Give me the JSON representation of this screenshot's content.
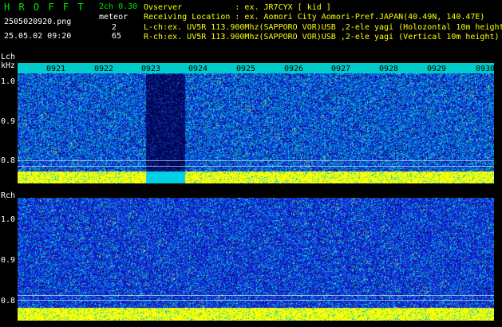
{
  "header": {
    "app_name": "H R O F F T",
    "mode": "2ch 0.30",
    "detect_label": "meteor",
    "filename": "2505020920.png",
    "datetime": "25.05.02 09:20",
    "count_l": "2",
    "count_r": "65",
    "observer_line": "Ovserver           : ex. JR7CYX [ kid ]",
    "location_line": "Receiving Location : ex. Aomori City Aomori-Pref.JAPAN(40.49N, 140.47E)",
    "lch_line": "L-ch:ex. UV5R 113.900Mhz(SAPPORO VOR)USB ,2-ele yagi (Holozontal 10m height)",
    "rch_line": "R-ch:ex. UV5R 113.900Mhz(SAPPORO VOR)USB ,2-ele yagi (Vertical 10m height)"
  },
  "lch": {
    "label": "Lch",
    "unit": "kHz",
    "ticks": [
      "0921",
      "0922",
      "0923",
      "0924",
      "0925",
      "0926",
      "0927",
      "0928",
      "0929",
      "0930"
    ],
    "y_labels": [
      "1.0",
      "0.9",
      "0.8"
    ]
  },
  "rch": {
    "label": "Rch",
    "y_labels": [
      "1.0",
      "0.9",
      "0.8"
    ]
  },
  "colors": {
    "header_green": "#00e600",
    "header_white": "#ffffff",
    "band_yellow": "#ffff00",
    "tick_strip": "#00cccc",
    "noise_blue": "#1a3cff",
    "noise_cyan": "#00cccc",
    "dark_band": "#000a66"
  }
}
